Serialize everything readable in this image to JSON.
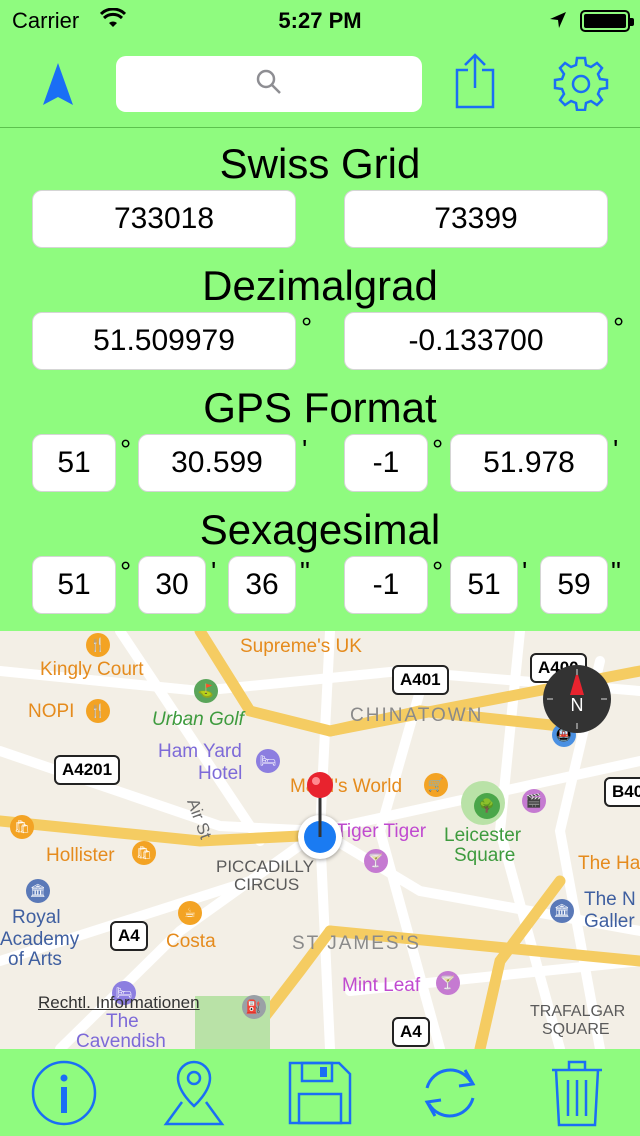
{
  "status_bar": {
    "carrier": "Carrier",
    "time": "5:27 PM"
  },
  "nav": {
    "search_placeholder": "",
    "accent_color": "#1a6ef5"
  },
  "coordinates": {
    "swiss_grid": {
      "title": "Swiss Grid",
      "east": "733018",
      "north": "73399"
    },
    "decimal": {
      "title": "Dezimalgrad",
      "lat": "51.509979",
      "lon": "-0.133700",
      "unit": "°"
    },
    "gps": {
      "title": "GPS Format",
      "lat_deg": "51",
      "lat_min": "30.599",
      "lon_deg": "-1",
      "lon_min": "51.978",
      "deg_unit": "°",
      "min_unit": "'"
    },
    "sexagesimal": {
      "title": "Sexagesimal",
      "lat_deg": "51",
      "lat_min": "30",
      "lat_sec": "36",
      "lon_deg": "-1",
      "lon_min": "51",
      "lon_sec": "59",
      "deg_unit": "°",
      "min_unit": "'",
      "sec_unit": "\""
    }
  },
  "map": {
    "labels": {
      "supremes": "Supreme's UK",
      "kingly": "Kingly Court",
      "nopi": "NOPI",
      "urban_golf": "Urban Golf",
      "chinatown": "CHINATOWN",
      "ham_yard": "Ham Yard",
      "hotel": "Hotel",
      "mms": "M&M's World",
      "air_st": "Air St",
      "tiger": "Tiger Tiger",
      "hollister": "Hollister",
      "piccadilly1": "PICCADILLY",
      "piccadilly2": "CIRCUS",
      "leicester1": "Leicester",
      "leicester2": "Square",
      "the_ha": "The Ha",
      "royal1": "Royal",
      "royal2": "Academy",
      "royal3": "of Arts",
      "costa": "Costa",
      "st_james": "ST JAMES'S",
      "the_n1": "The N",
      "the_n2": "Galler",
      "mint_leaf": "Mint Leaf",
      "legal": "Rechtl. Informationen",
      "cavendish1": "The",
      "cavendish2": "Cavendish",
      "trafalgar1": "TRAFALGAR",
      "trafalgar2": "SQUARE"
    },
    "road_badges": {
      "a401": "A401",
      "a400": "A400",
      "a4201": "A4201",
      "b40": "B40",
      "a4_left": "A4",
      "a4_bottom": "A4"
    },
    "compass_label": "N"
  },
  "tabbar": {
    "items": [
      "info-icon",
      "map-pin-icon",
      "save-icon",
      "refresh-icon",
      "trash-icon"
    ]
  }
}
